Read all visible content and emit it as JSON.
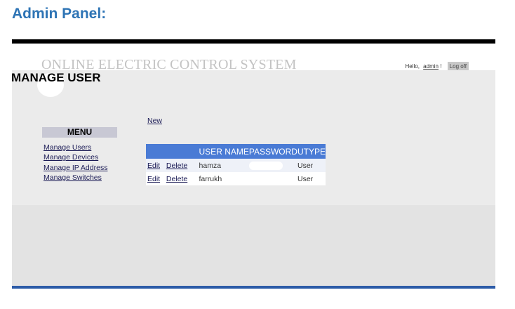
{
  "doc_heading": "Admin Panel:",
  "site": {
    "title": "ONLINE ELECTRIC CONTROL SYSTEM",
    "greeting_prefix": "Hello,",
    "username": "admin",
    "greeting_suffix": "!",
    "logoff_label": "Log off"
  },
  "page": {
    "title": "MANAGE USER"
  },
  "menu": {
    "title": "MENU",
    "items": [
      {
        "label": "Manage Users"
      },
      {
        "label": "Manage Devices"
      },
      {
        "label": "Manage IP Address"
      },
      {
        "label": "Manage Switches"
      }
    ]
  },
  "new_link": "New",
  "table": {
    "headers": [
      "",
      "USER NAME",
      "PASSWORD",
      "UTYPE"
    ],
    "edit_label": "Edit",
    "delete_label": "Delete",
    "rows": [
      {
        "username": "hamza",
        "utype": "User"
      },
      {
        "username": "farrukh",
        "utype": "User"
      }
    ]
  },
  "colors": {
    "heading": "#2e74b5",
    "table_header": "#4a7bd5",
    "menu_box": "#c8c8d4"
  }
}
